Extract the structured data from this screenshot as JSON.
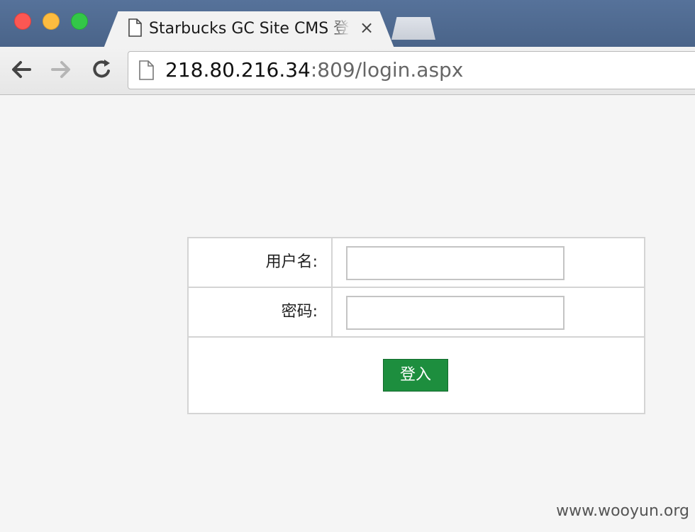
{
  "window": {
    "tab_title": "Starbucks GC Site CMS 登录",
    "tab_close": "×"
  },
  "address_bar": {
    "host": "218.80.216.34",
    "rest": ":809/login.aspx"
  },
  "login": {
    "username_label": "用户名:",
    "password_label": "密码:",
    "username_value": "",
    "password_value": "",
    "submit_label": "登入"
  },
  "colors": {
    "accent_button": "#1d8e3e",
    "titlebar": "#4a6489"
  },
  "icons": [
    "page-icon",
    "back-arrow-icon",
    "forward-arrow-icon",
    "reload-icon",
    "close-icon"
  ],
  "watermark": "www.wooyun.org"
}
